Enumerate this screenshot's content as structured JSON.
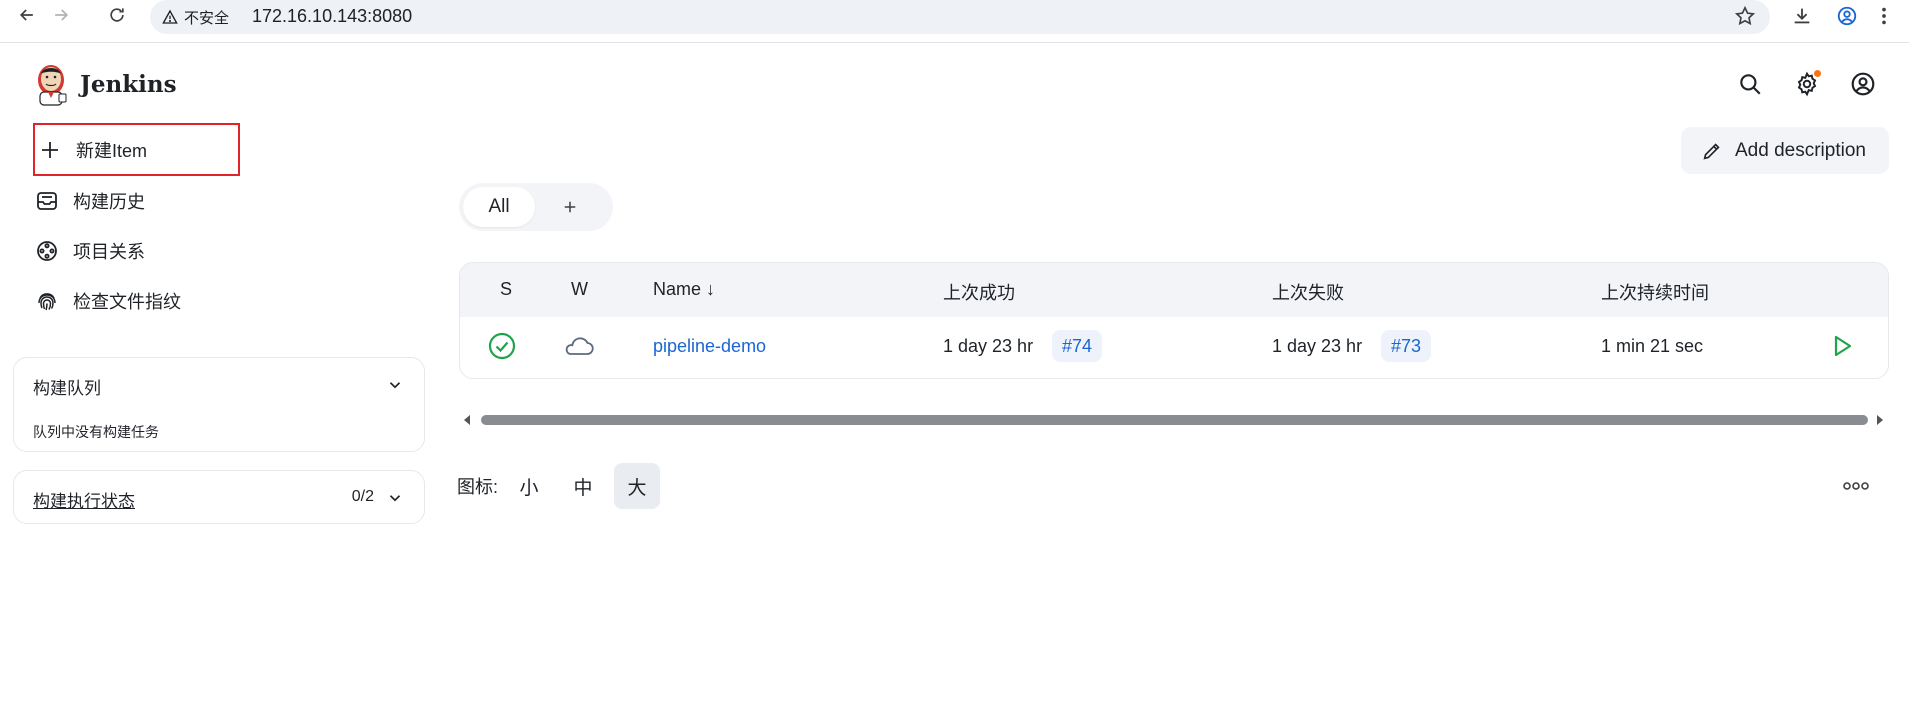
{
  "browser": {
    "security_label": "不安全",
    "url": "172.16.10.143:8080"
  },
  "header": {
    "brand": "Jenkins",
    "icons": [
      "search-icon",
      "gear-icon",
      "user-icon"
    ],
    "notification_color": "#f97316"
  },
  "side_tasks": [
    {
      "label": "新建Item",
      "icon": "plus-icon"
    },
    {
      "label": "构建历史",
      "icon": "inbox-icon"
    },
    {
      "label": "项目关系",
      "icon": "relationship-icon"
    },
    {
      "label": "检查文件指纹",
      "icon": "fingerprint-icon"
    }
  ],
  "build_queue": {
    "title": "构建队列",
    "empty_note": "队列中没有构建任务"
  },
  "executors": {
    "title": "构建执行状态",
    "count": "0/2"
  },
  "main": {
    "add_description": "Add description",
    "tabs": [
      {
        "label": "All",
        "active": true
      }
    ]
  },
  "table": {
    "columns": [
      "S",
      "W",
      "Name ↓",
      "上次成功",
      "上次失败",
      "上次持续时间"
    ],
    "rows": [
      {
        "status": "success-icon",
        "weather": "cloud-icon",
        "name": "pipeline-demo",
        "last_success": "1 day 23 hr",
        "last_success_build": "#74",
        "last_failure": "1 day 23 hr",
        "last_failure_build": "#73",
        "last_duration": "1 min 21 sec"
      }
    ]
  },
  "icon_size": {
    "label": "图标:",
    "options": [
      "小",
      "中",
      "大"
    ],
    "selected": "大"
  },
  "colors": {
    "accent": "#1a66d2",
    "success": "#1ea54c",
    "highlight_box": "#e0242a"
  }
}
